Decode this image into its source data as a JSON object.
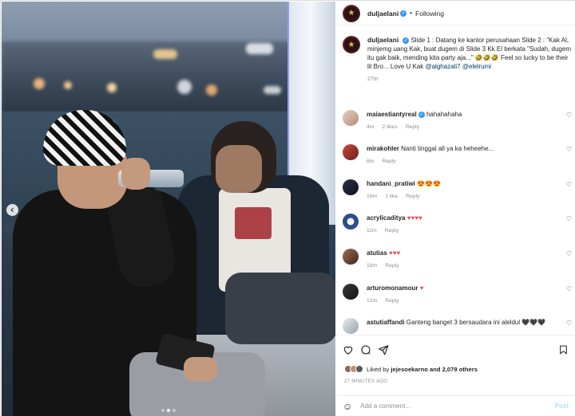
{
  "header": {
    "username": "duljaelani",
    "follow_status": "Following",
    "separator": "•"
  },
  "caption": {
    "username": "duljaelani",
    "text": "Slide 1 : Datang ke kantor perusahaan Slide 2 : \"Kak Al, minjemg uang Kak, buat dugem di Slide 3 Kk El berkata \"Sudah, dugem itu gak baik, mending kita party aja...\" 🤣🤣🤣 Feel so lucky to be their lil Bro... Love U Kak",
    "mention_1": "@alghazali7",
    "mention_2": "@elelrumi",
    "time": "27m"
  },
  "comments": [
    {
      "username": "maiaestiantyreal",
      "text": "hahahahaha",
      "time": "4m",
      "likes": "2 likes",
      "reply": "Reply",
      "verified": true
    },
    {
      "username": "mirakohler",
      "text": "Nanti tinggal all ya ka heheehe...",
      "time": "6m",
      "likes": "",
      "reply": "Reply"
    },
    {
      "username": "handani_pratiwi",
      "text": "😍😍😍",
      "time": "16m",
      "likes": "1 like",
      "reply": "Reply"
    },
    {
      "username": "acrylicaditya",
      "text": "♥♥♥♥",
      "time": "11m",
      "likes": "",
      "reply": "Reply"
    },
    {
      "username": "atutias",
      "text": "♥♥♥",
      "time": "18m",
      "likes": "",
      "reply": "Reply"
    },
    {
      "username": "arturomonamour",
      "text": "♥",
      "time": "12m",
      "likes": "",
      "reply": "Reply"
    },
    {
      "username": "astutiaffandi",
      "text": "Ganteng banget 3 bersaudara ini aleldul 🖤🖤🖤",
      "time": "",
      "likes": "",
      "reply": ""
    }
  ],
  "likes": {
    "prefix": "Liked by",
    "user": "jejesoekarno",
    "suffix": "and 2,079 others"
  },
  "post_time": "27 MINUTES AGO",
  "add_comment": {
    "placeholder": "Add a comment...",
    "post_label": "Post"
  },
  "icons": {
    "like": "heart-icon",
    "comment": "comment-icon",
    "share": "share-icon",
    "save": "bookmark-icon",
    "emoji": "emoji-icon",
    "prev": "chevron-left-icon"
  },
  "carousel": {
    "total": 3,
    "active": 1
  },
  "colors": {
    "verified": "#3897f0",
    "link": "#00376b",
    "heart": "#ed4956",
    "meta": "#8e8e8e"
  }
}
